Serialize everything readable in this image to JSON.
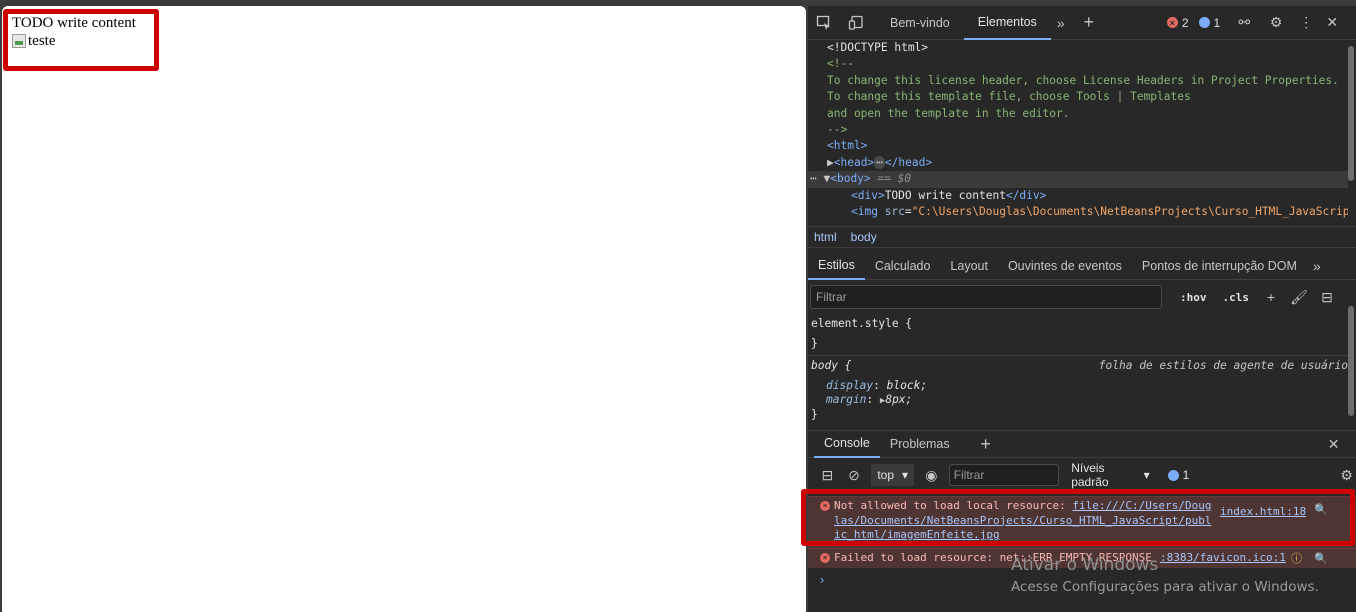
{
  "page": {
    "text": "TODO write content",
    "img_alt": "teste"
  },
  "devtools": {
    "tabs": [
      "Bem-vindo",
      "Elementos"
    ],
    "error_count": "2",
    "info_count": "1",
    "dom": {
      "doctype": "<!DOCTYPE html>",
      "comment_open": "<!--",
      "comment_lines": [
        "To change this license header, choose License Headers in Project Properties.",
        "To change this template file, choose Tools | Templates",
        "and open the template in the editor."
      ],
      "comment_close": "-->",
      "html_open": "<html>",
      "head": "<head>",
      "head_close": "</head>",
      "body_open": "<body>",
      "body_sel": "== $0",
      "div_open": "<div>",
      "div_text": "TODO write content",
      "div_close": "</div>",
      "img_tag": "<img ",
      "img_attr": "src",
      "img_val": "\"C:\\Users\\Douglas\\Documents\\NetBeansProjects\\Curso_HTML_JavaScript"
    },
    "breadcrumbs": [
      "html",
      "body"
    ],
    "styles_tabs": [
      "Estilos",
      "Calculado",
      "Layout",
      "Ouvintes de eventos",
      "Pontos de interrupção DOM"
    ],
    "filter_placeholder": "Filtrar",
    "hov": ":hov",
    "cls": ".cls",
    "rules": {
      "element_style": "element.style {",
      "close": "}",
      "body_selector": "body {",
      "ua_label": "folha de estilos de agente de usuário",
      "display_name": "display",
      "display_val": "block;",
      "margin_name": "margin",
      "margin_val": "8px;"
    },
    "drawer_tabs": [
      "Console",
      "Problemas"
    ],
    "console": {
      "context": "top",
      "filter_placeholder": "Filtrar",
      "levels": "Níveis padrão",
      "issues": "1",
      "msg1_text": "Not allowed to load local resource: ",
      "msg1_link": "file:///C:/Users/Douglas/Documents/NetBeansProjects/Curso_HTML_JavaScript/public_html/imagemEnfeite.jpg",
      "msg1_link_lines": [
        "file:///C:/Users/Doug",
        "las/Documents/NetBeansProjects/Curso_HTML_JavaScript/publ",
        "ic_html/imagemEnfeite.jpg"
      ],
      "msg1_source": "index.html:18",
      "msg2_text": "Failed to load resource: net::ERR_EMPTY_RESPONSE",
      "msg2_source": ":8383/favicon.ico:1"
    }
  },
  "watermark": {
    "title": "Ativar o Windows",
    "subtitle": "Acesse Configurações para ativar o Windows."
  },
  "colors": {
    "highlight": "#d10000",
    "devtools_bg": "#282828",
    "error_bg": "#4e3534"
  }
}
